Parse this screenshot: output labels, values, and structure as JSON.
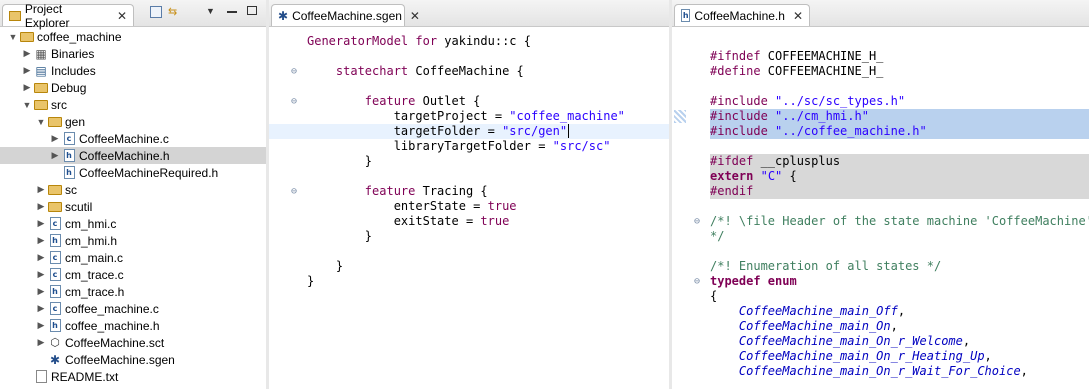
{
  "explorer": {
    "tab_label": "Project Explorer",
    "tree": [
      {
        "label": "coffee_machine",
        "indent": 0,
        "twisty": "▼",
        "icon": "project"
      },
      {
        "label": "Binaries",
        "indent": 1,
        "twisty": "▶",
        "icon": "binaries"
      },
      {
        "label": "Includes",
        "indent": 1,
        "twisty": "▶",
        "icon": "includes"
      },
      {
        "label": "Debug",
        "indent": 1,
        "twisty": "▶",
        "icon": "folder"
      },
      {
        "label": "src",
        "indent": 1,
        "twisty": "▼",
        "icon": "folder"
      },
      {
        "label": "gen",
        "indent": 2,
        "twisty": "▼",
        "icon": "folder"
      },
      {
        "label": "CoffeeMachine.c",
        "indent": 3,
        "twisty": "▶",
        "icon": "c-file"
      },
      {
        "label": "CoffeeMachine.h",
        "indent": 3,
        "twisty": "▶",
        "icon": "h-file",
        "selected": true
      },
      {
        "label": "CoffeeMachineRequired.h",
        "indent": 3,
        "twisty": "",
        "icon": "h-file"
      },
      {
        "label": "sc",
        "indent": 2,
        "twisty": "▶",
        "icon": "folder"
      },
      {
        "label": "scutil",
        "indent": 2,
        "twisty": "▶",
        "icon": "folder"
      },
      {
        "label": "cm_hmi.c",
        "indent": 2,
        "twisty": "▶",
        "icon": "c-file"
      },
      {
        "label": "cm_hmi.h",
        "indent": 2,
        "twisty": "▶",
        "icon": "h-file"
      },
      {
        "label": "cm_main.c",
        "indent": 2,
        "twisty": "▶",
        "icon": "c-file"
      },
      {
        "label": "cm_trace.c",
        "indent": 2,
        "twisty": "▶",
        "icon": "c-file"
      },
      {
        "label": "cm_trace.h",
        "indent": 2,
        "twisty": "▶",
        "icon": "h-file"
      },
      {
        "label": "coffee_machine.c",
        "indent": 2,
        "twisty": "▶",
        "icon": "c-file"
      },
      {
        "label": "coffee_machine.h",
        "indent": 2,
        "twisty": "▶",
        "icon": "h-file"
      },
      {
        "label": "CoffeeMachine.sct",
        "indent": 2,
        "twisty": "▶",
        "icon": "statechart"
      },
      {
        "label": "CoffeeMachine.sgen",
        "indent": 2,
        "twisty": "",
        "icon": "gear"
      },
      {
        "label": "README.txt",
        "indent": 1,
        "twisty": "",
        "icon": "txt-file"
      }
    ]
  },
  "editor1": {
    "tab_label": "CoffeeMachine.sgen",
    "lines": [
      {
        "tokens": [
          [
            "kw2",
            "GeneratorModel for "
          ],
          [
            "",
            "yakindu::c {"
          ]
        ]
      },
      {
        "tokens": []
      },
      {
        "fold": "⊖",
        "tokens": [
          [
            "",
            "    "
          ],
          [
            "kw2",
            "statechart"
          ],
          [
            "",
            " CoffeeMachine {"
          ]
        ]
      },
      {
        "tokens": []
      },
      {
        "fold": "⊖",
        "tokens": [
          [
            "",
            "        "
          ],
          [
            "kw2",
            "feature"
          ],
          [
            "",
            " Outlet {"
          ]
        ]
      },
      {
        "tokens": [
          [
            "",
            "            targetProject = "
          ],
          [
            "str",
            "\"coffee_machine\""
          ]
        ]
      },
      {
        "hl": "line",
        "tokens": [
          [
            "",
            "            targetFolder = "
          ],
          [
            "str",
            "\"src/gen\""
          ]
        ]
      },
      {
        "tokens": [
          [
            "",
            "            libraryTargetFolder = "
          ],
          [
            "str",
            "\"src/sc\""
          ]
        ]
      },
      {
        "tokens": [
          [
            "",
            "        }"
          ]
        ]
      },
      {
        "tokens": []
      },
      {
        "fold": "⊖",
        "tokens": [
          [
            "",
            "        "
          ],
          [
            "kw2",
            "feature"
          ],
          [
            "",
            " Tracing {"
          ]
        ]
      },
      {
        "tokens": [
          [
            "",
            "            enterState = "
          ],
          [
            "kw2",
            "true"
          ]
        ]
      },
      {
        "tokens": [
          [
            "",
            "            exitState = "
          ],
          [
            "kw2",
            "true"
          ]
        ]
      },
      {
        "tokens": [
          [
            "",
            "        }"
          ]
        ]
      },
      {
        "tokens": []
      },
      {
        "tokens": [
          [
            "",
            "    }"
          ]
        ]
      },
      {
        "tokens": [
          [
            "",
            "}"
          ]
        ]
      }
    ]
  },
  "editor2": {
    "tab_label": "CoffeeMachine.h",
    "lines": [
      {
        "tokens": []
      },
      {
        "tokens": [
          [
            "pp",
            "#ifndef"
          ],
          [
            "",
            " COFFEEMACHINE_H_"
          ]
        ]
      },
      {
        "tokens": [
          [
            "pp",
            "#define"
          ],
          [
            "",
            " COFFEEMACHINE_H_"
          ]
        ]
      },
      {
        "tokens": []
      },
      {
        "tokens": [
          [
            "pp",
            "#include"
          ],
          [
            "",
            " "
          ],
          [
            "str",
            "\"../sc/sc_types.h\""
          ]
        ]
      },
      {
        "hl": "sel",
        "mark": true,
        "tokens": [
          [
            "pp",
            "#include"
          ],
          [
            "",
            " "
          ],
          [
            "str",
            "\"../cm_hmi.h\""
          ]
        ]
      },
      {
        "hl": "sel",
        "tokens": [
          [
            "pp",
            "#include"
          ],
          [
            "",
            " "
          ],
          [
            "str",
            "\"../coffee_machine.h\""
          ]
        ]
      },
      {
        "tokens": []
      },
      {
        "hl": "grey",
        "tokens": [
          [
            "pp",
            "#ifdef"
          ],
          [
            "",
            " __cplusplus"
          ]
        ]
      },
      {
        "hl": "grey",
        "tokens": [
          [
            "kw",
            "extern"
          ],
          [
            "",
            " "
          ],
          [
            "str",
            "\"C\""
          ],
          [
            "",
            " {"
          ]
        ]
      },
      {
        "hl": "grey",
        "tokens": [
          [
            "pp",
            "#endif"
          ]
        ]
      },
      {
        "tokens": []
      },
      {
        "fold": "⊖",
        "tokens": [
          [
            "cm",
            "/*! \\file Header of the state machine 'CoffeeMachine'."
          ]
        ]
      },
      {
        "tokens": [
          [
            "cm",
            "*/"
          ]
        ]
      },
      {
        "tokens": []
      },
      {
        "tokens": [
          [
            "cm",
            "/*! Enumeration of all states */"
          ]
        ]
      },
      {
        "fold": "⊖",
        "tokens": [
          [
            "kw",
            "typedef enum"
          ]
        ]
      },
      {
        "tokens": [
          [
            "",
            "{"
          ]
        ]
      },
      {
        "tokens": [
          [
            "",
            "    "
          ],
          [
            "en",
            "CoffeeMachine_main_Off"
          ],
          [
            "",
            ","
          ]
        ]
      },
      {
        "tokens": [
          [
            "",
            "    "
          ],
          [
            "en",
            "CoffeeMachine_main_On"
          ],
          [
            "",
            ","
          ]
        ]
      },
      {
        "tokens": [
          [
            "",
            "    "
          ],
          [
            "en",
            "CoffeeMachine_main_On_r_Welcome"
          ],
          [
            "",
            ","
          ]
        ]
      },
      {
        "tokens": [
          [
            "",
            "    "
          ],
          [
            "en",
            "CoffeeMachine_main_On_r_Heating_Up"
          ],
          [
            "",
            ","
          ]
        ]
      },
      {
        "tokens": [
          [
            "",
            "    "
          ],
          [
            "en",
            "CoffeeMachine_main_On_r_Wait_For_Choice"
          ],
          [
            "",
            ","
          ]
        ]
      }
    ]
  }
}
